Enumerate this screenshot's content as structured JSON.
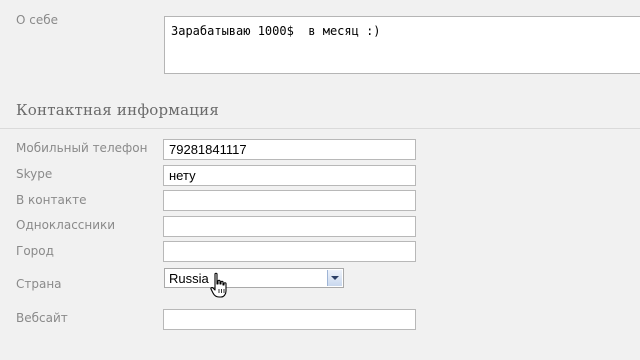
{
  "about": {
    "label": "О себе",
    "value": "Зарабатываю 1000$  в месяц :)"
  },
  "contact_section": {
    "title": "Контактная информация"
  },
  "fields": {
    "mobile": {
      "label": "Мобильный телефон",
      "value": "79281841117"
    },
    "skype": {
      "label": "Skype",
      "value": "нету"
    },
    "vkontakte": {
      "label": "В контакте",
      "value": ""
    },
    "odnoklassniki": {
      "label": "Одноклассники",
      "value": ""
    },
    "city": {
      "label": "Город",
      "value": ""
    },
    "country": {
      "label": "Страна",
      "value": "Russia"
    },
    "website": {
      "label": "Вебсайт",
      "value": ""
    }
  },
  "icons": {
    "cursor": "hand-pointer-icon",
    "dropdown": "chevron-down-icon"
  }
}
